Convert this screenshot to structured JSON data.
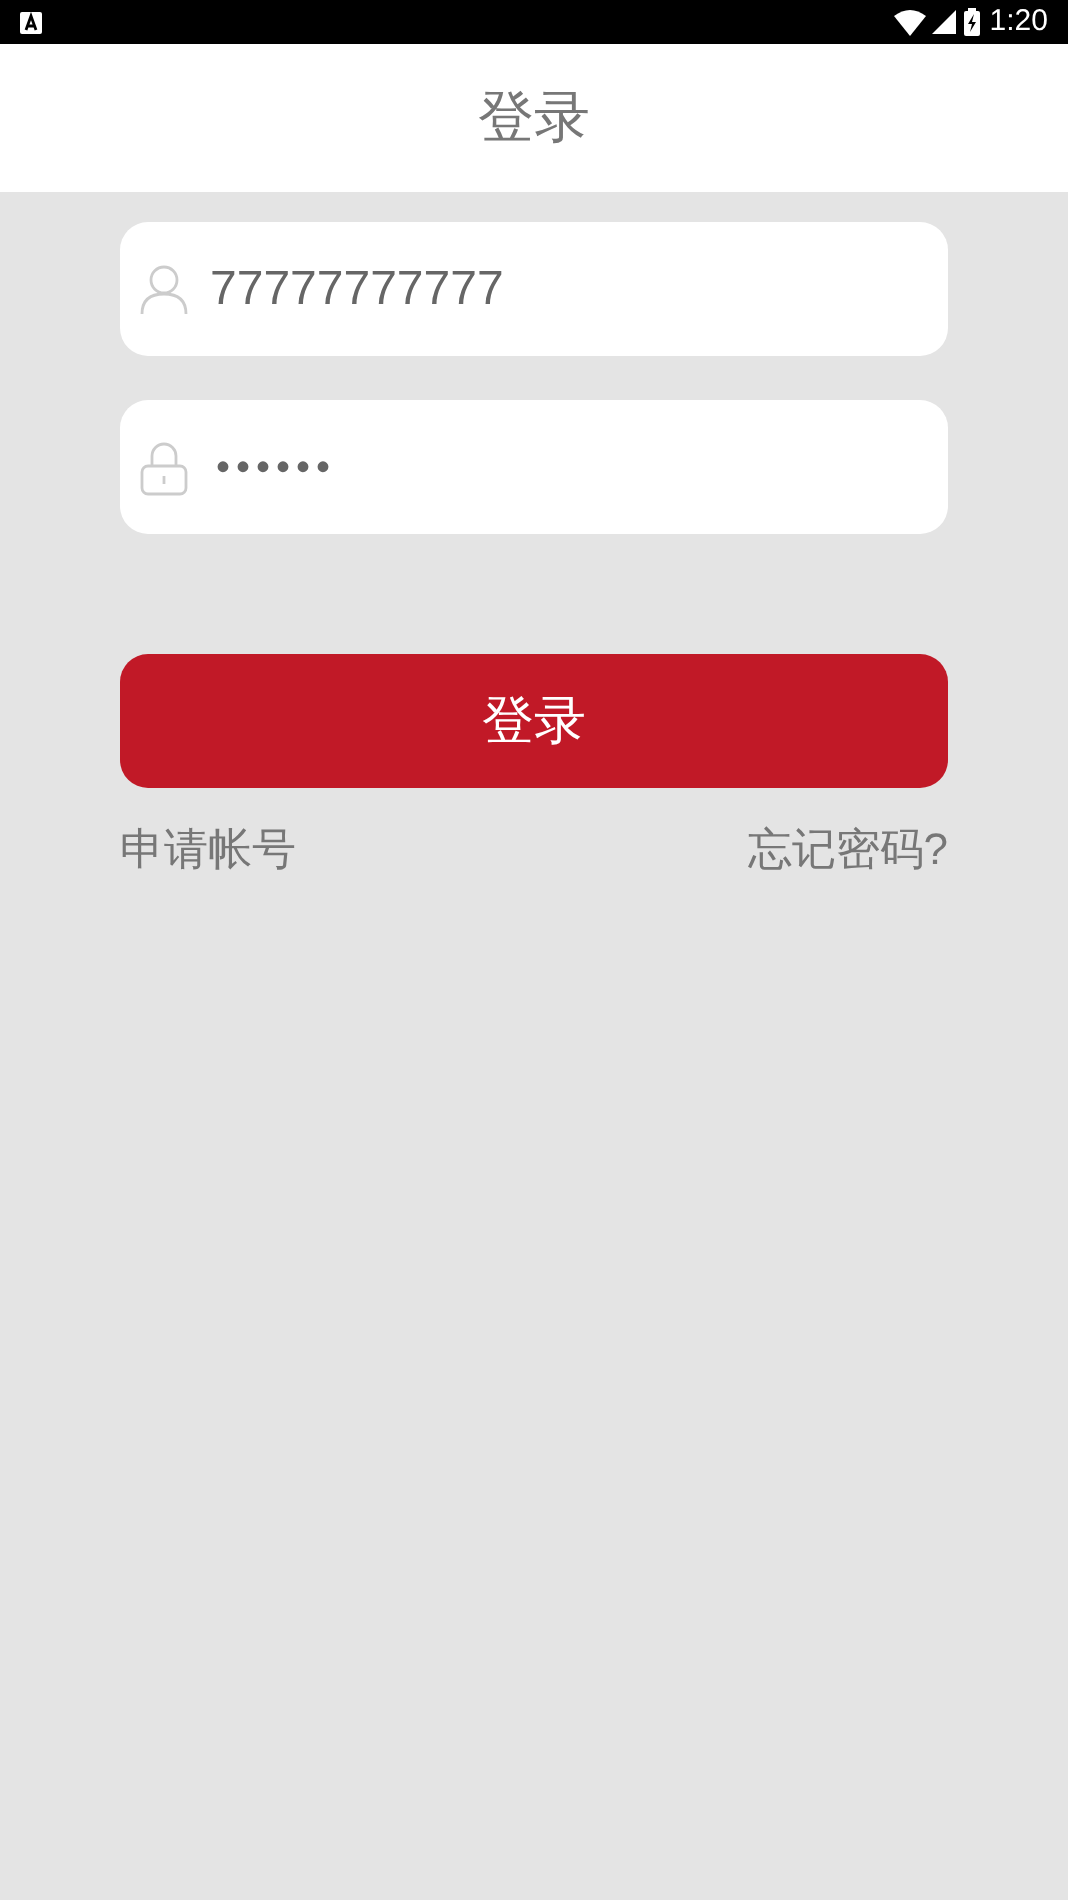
{
  "status_bar": {
    "time": "1:20"
  },
  "header": {
    "title": "登录"
  },
  "username_field": {
    "value": "77777777777"
  },
  "password_field": {
    "value": "••••••"
  },
  "login_button": {
    "label": "登录"
  },
  "links": [
    {
      "label": "申请帐号"
    },
    {
      "label": "忘记密码?"
    }
  ]
}
